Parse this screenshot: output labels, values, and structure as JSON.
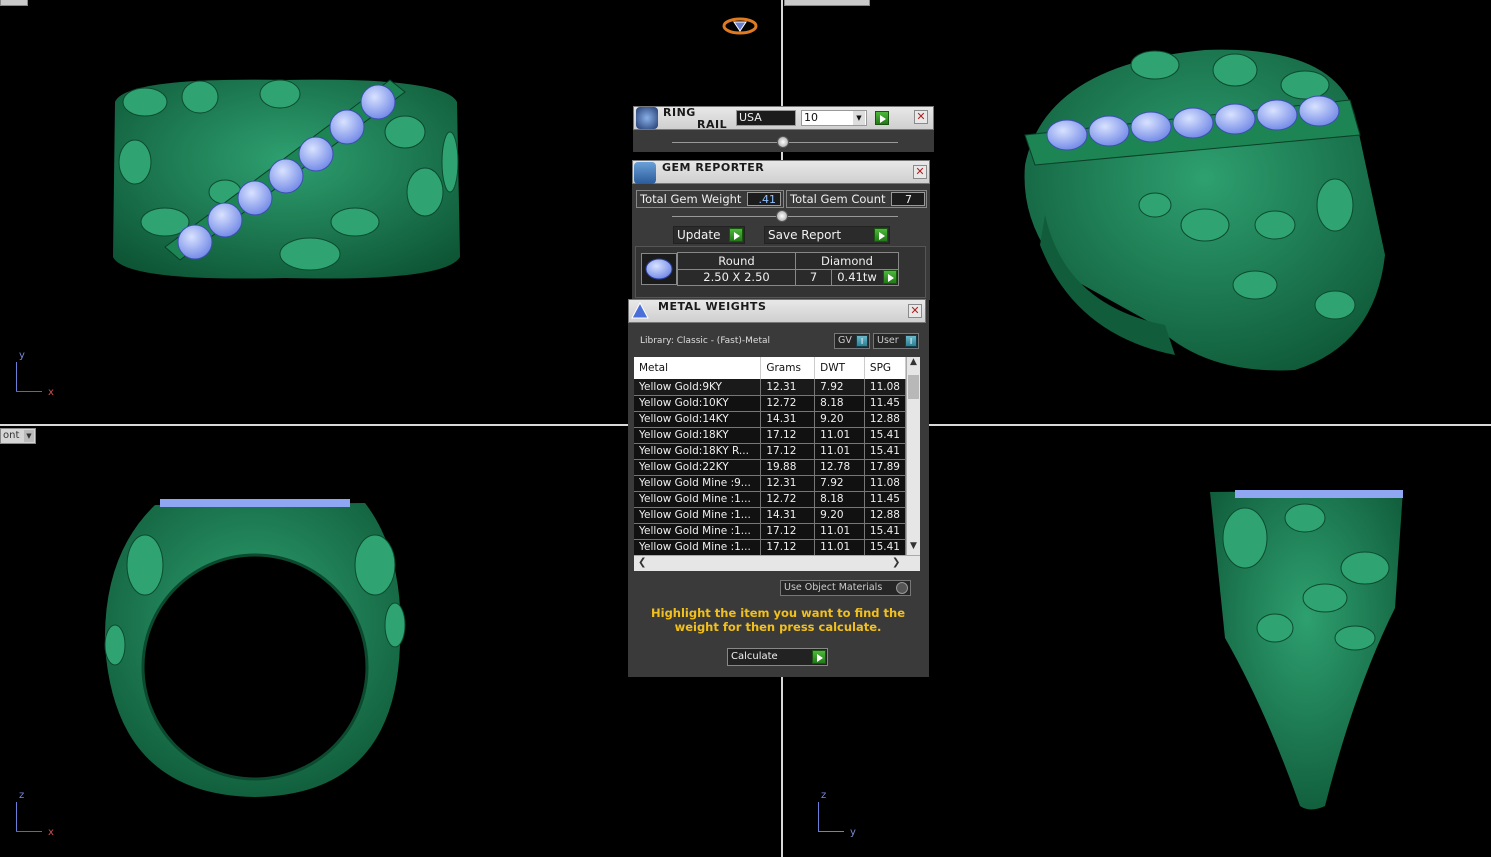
{
  "viewports": {
    "top_left_axes": {
      "v": "y",
      "h": "x"
    },
    "bottom_left_axes": {
      "v": "z",
      "h": "x"
    },
    "bottom_right_axes": {
      "v": "z",
      "h": "y"
    },
    "bottom_left_view_label": "ont"
  },
  "ring_rail": {
    "title_line1": "RING",
    "title_line2": "RAIL",
    "country": "USA",
    "size": "10"
  },
  "gem_reporter": {
    "title": "GEM REPORTER",
    "total_gem_weight_label": "Total Gem Weight",
    "total_gem_weight_value": ".41",
    "total_gem_count_label": "Total Gem Count",
    "total_gem_count_value": "7",
    "update_label": "Update",
    "save_report_label": "Save Report",
    "row": {
      "shape": "Round",
      "size": "2.50 X 2.50",
      "material": "Diamond",
      "count": "7",
      "weight": "0.41tw"
    }
  },
  "metal_weights": {
    "title": "METAL WEIGHTS",
    "library": "Library: Classic - (Fast)-Metal",
    "gv_label": "GV",
    "user_label": "User",
    "columns": [
      "Metal",
      "Grams",
      "DWT",
      "SPG"
    ],
    "rows": [
      [
        "Yellow Gold:9KY",
        "12.31",
        "7.92",
        "11.08"
      ],
      [
        "Yellow Gold:10KY",
        "12.72",
        "8.18",
        "11.45"
      ],
      [
        "Yellow Gold:14KY",
        "14.31",
        "9.20",
        "12.88"
      ],
      [
        "Yellow Gold:18KY",
        "17.12",
        "11.01",
        "15.41"
      ],
      [
        "Yellow Gold:18KY R...",
        "17.12",
        "11.01",
        "15.41"
      ],
      [
        "Yellow Gold:22KY",
        "19.88",
        "12.78",
        "17.89"
      ],
      [
        "Yellow Gold Mine :9...",
        "12.31",
        "7.92",
        "11.08"
      ],
      [
        "Yellow Gold Mine :1...",
        "12.72",
        "8.18",
        "11.45"
      ],
      [
        "Yellow Gold Mine :1...",
        "14.31",
        "9.20",
        "12.88"
      ],
      [
        "Yellow Gold Mine :1...",
        "17.12",
        "11.01",
        "15.41"
      ],
      [
        "Yellow Gold Mine :1...",
        "17.12",
        "11.01",
        "15.41"
      ]
    ],
    "use_object_materials_label": "Use Object Materials",
    "hint": "Highlight the item you want to find the weight for then press calculate.",
    "calculate_label": "Calculate"
  },
  "colors": {
    "ring_green": "#1f8a5a",
    "gem_blue": "#8fa6f2",
    "hint_yellow": "#f2c01c",
    "panel_dark": "#3a3a3a"
  }
}
